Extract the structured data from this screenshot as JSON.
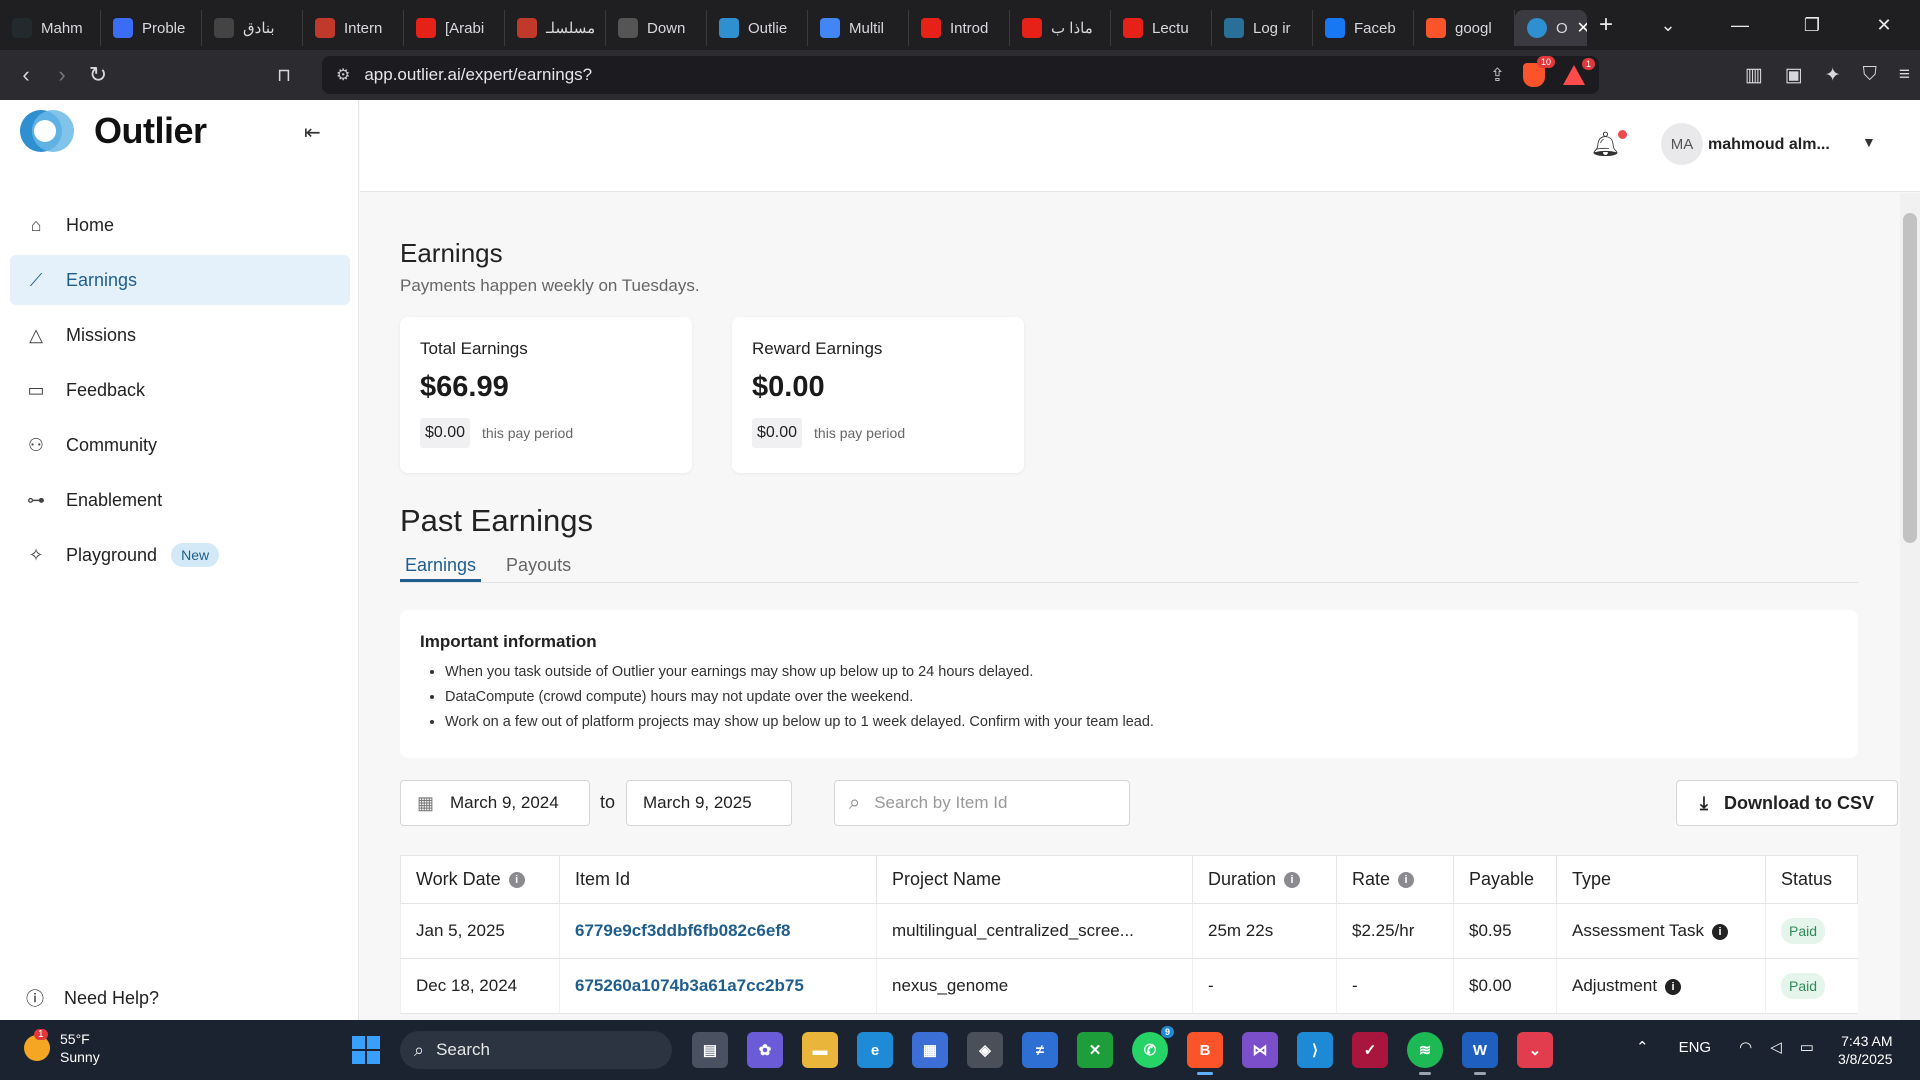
{
  "browser": {
    "tabs": [
      {
        "label": "Mahm",
        "icon": "github-icon",
        "color": "#24292e"
      },
      {
        "label": "Proble",
        "icon": "chart-icon",
        "color": "#3b6cf6"
      },
      {
        "label": "بنادق",
        "icon": "openai-icon",
        "color": "#444"
      },
      {
        "label": "Intern",
        "icon": "speedometer-icon",
        "color": "#c0392b"
      },
      {
        "label": "[Arabi",
        "icon": "youtube-icon",
        "color": "#e62117"
      },
      {
        "label": "مسلسلـ",
        "icon": "pin-icon",
        "color": "#c0392b"
      },
      {
        "label": "Down",
        "icon": "download-icon",
        "color": "#555"
      },
      {
        "label": "Outlie",
        "icon": "outlier-icon",
        "color": "#2e8fd1"
      },
      {
        "label": "Multil",
        "icon": "docs-icon",
        "color": "#4285f4"
      },
      {
        "label": "Introd",
        "icon": "youtube-icon",
        "color": "#e62117"
      },
      {
        "label": "ماذا ب",
        "icon": "youtube-icon",
        "color": "#e62117"
      },
      {
        "label": "Lectu",
        "icon": "youtube-icon",
        "color": "#e62117"
      },
      {
        "label": "Log ir",
        "icon": "user-icon",
        "color": "#2a6f97"
      },
      {
        "label": "Faceb",
        "icon": "facebook-icon",
        "color": "#1877f2"
      },
      {
        "label": "googl",
        "icon": "brave-icon",
        "color": "#fb542b"
      }
    ],
    "active_tab": {
      "label": "O",
      "icon": "outlier-icon",
      "close": "✕"
    },
    "new_tab": "+",
    "url": "app.outlier.ai/expert/earnings?",
    "shield_badge": "10",
    "rewards_badge": "1"
  },
  "sidebar": {
    "brand": "Outlier",
    "items": [
      {
        "label": "Home",
        "icon": "home-icon",
        "glyph": "⌂"
      },
      {
        "label": "Earnings",
        "icon": "chart-line-icon",
        "glyph": "⟋"
      },
      {
        "label": "Missions",
        "icon": "mountain-icon",
        "glyph": "△"
      },
      {
        "label": "Feedback",
        "icon": "chat-bubbles-icon",
        "glyph": "▭"
      },
      {
        "label": "Community",
        "icon": "users-icon",
        "glyph": "⚇"
      },
      {
        "label": "Enablement",
        "icon": "dumbbell-icon",
        "glyph": "⊶"
      },
      {
        "label": "Playground",
        "icon": "sparkles-icon",
        "glyph": "✧"
      }
    ],
    "new_badge": "New",
    "help": "Need Help?"
  },
  "header": {
    "avatar_initials": "MA",
    "user_name": "mahmoud alm..."
  },
  "page": {
    "title": "Earnings",
    "subtitle": "Payments happen weekly on Tuesdays.",
    "total_card": {
      "title": "Total Earnings",
      "value": "$66.99",
      "period_value": "$0.00",
      "period_note": "this pay period"
    },
    "reward_card": {
      "title": "Reward Earnings",
      "value": "$0.00",
      "period_value": "$0.00",
      "period_note": "this pay period"
    },
    "past_title": "Past Earnings",
    "tabs": [
      "Earnings",
      "Payouts"
    ],
    "info": {
      "title": "Important information",
      "bullets": [
        "When you task outside of Outlier your earnings may show up below up to 24 hours delayed.",
        "DataCompute (crowd compute) hours may not update over the weekend.",
        "Work on a few out of platform projects may show up below up to 1 week delayed. Confirm with your team lead."
      ]
    },
    "filters": {
      "from_date": "March 9, 2024",
      "to_label": "to",
      "to_date": "March 9, 2025",
      "search_placeholder": "Search by Item Id",
      "csv_label": "Download to CSV"
    },
    "table": {
      "headers": [
        "Work Date",
        "Item Id",
        "Project Name",
        "Duration",
        "Rate",
        "Payable",
        "Type",
        "Status"
      ],
      "rows": [
        {
          "date": "Jan 5, 2025",
          "item_id": "6779e9cf3ddbf6fb082c6ef8",
          "project": "multilingual_centralized_scree...",
          "duration": "25m 22s",
          "rate": "$2.25/hr",
          "payable": "$0.95",
          "type": "Assessment Task",
          "status": "Paid"
        },
        {
          "date": "Dec 18, 2024",
          "item_id": "675260a1074b3a61a7cc2b75",
          "project": "nexus_genome",
          "duration": "-",
          "rate": "-",
          "payable": "$0.00",
          "type": "Adjustment",
          "status": "Paid"
        }
      ]
    }
  },
  "taskbar": {
    "weather_temp": "55°F",
    "weather_desc": "Sunny",
    "weather_badge": "1",
    "search_label": "Search",
    "whatsapp_badge": "9",
    "lang": "ENG",
    "time": "7:43 AM",
    "date": "3/8/2025"
  }
}
